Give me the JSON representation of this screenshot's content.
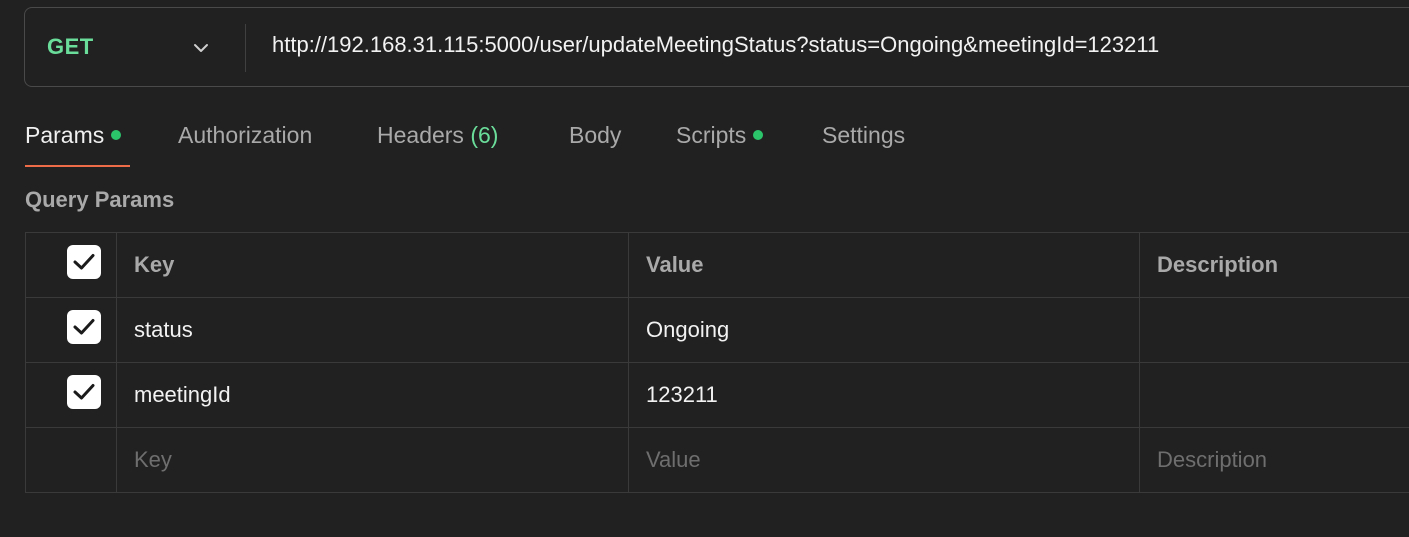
{
  "request": {
    "method": "GET",
    "url": "http://192.168.31.115:5000/user/updateMeetingStatus?status=Ongoing&meetingId=123211"
  },
  "tabs": [
    {
      "label": "Params",
      "active": true,
      "indicator": true
    },
    {
      "label": "Authorization"
    },
    {
      "label": "Headers",
      "count": "(6)"
    },
    {
      "label": "Body"
    },
    {
      "label": "Scripts",
      "indicator": true
    },
    {
      "label": "Settings"
    }
  ],
  "query_params": {
    "title": "Query Params",
    "columns": [
      "Key",
      "Value",
      "Description"
    ],
    "rows": [
      {
        "checked": true,
        "key": "status",
        "value": "Ongoing",
        "description": ""
      },
      {
        "checked": true,
        "key": "meetingId",
        "value": "123211",
        "description": ""
      }
    ],
    "placeholders": {
      "key": "Key",
      "value": "Value",
      "description": "Description"
    }
  },
  "colors": {
    "method": "#6bdd9a",
    "active_tab_underline": "#ef6c49",
    "indicator_dot": "#2bc46b",
    "background": "#212121"
  }
}
